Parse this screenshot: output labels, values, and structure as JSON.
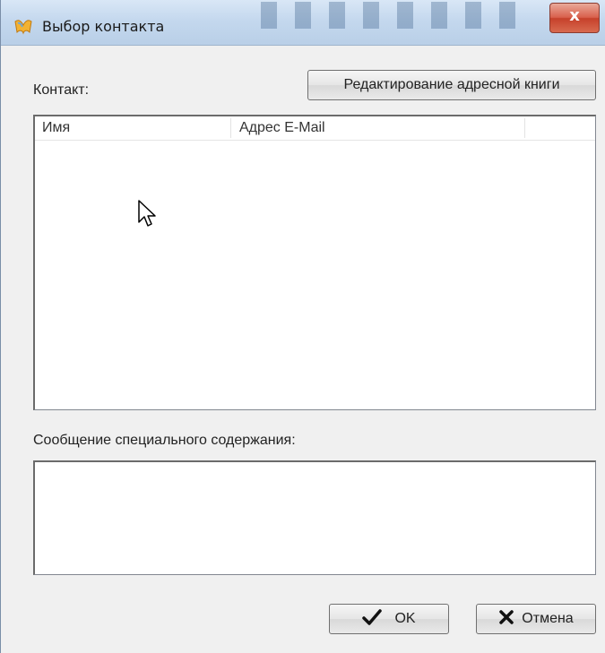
{
  "window": {
    "title": "Выбор контакта",
    "close_label": "x"
  },
  "contact": {
    "label": "Контакт:",
    "edit_address_book_label": "Редактирование адресной книги",
    "columns": [
      "Имя",
      "Адрес E-Mail"
    ],
    "rows": []
  },
  "message": {
    "label": "Сообщение специального содержания:",
    "value": ""
  },
  "buttons": {
    "ok_label": "OK",
    "ok_icon": "check-icon",
    "cancel_label": "Отмена",
    "cancel_icon": "x-icon"
  },
  "colors": {
    "close_button": "#c6412b",
    "titlebar": "#c4d8ee"
  }
}
